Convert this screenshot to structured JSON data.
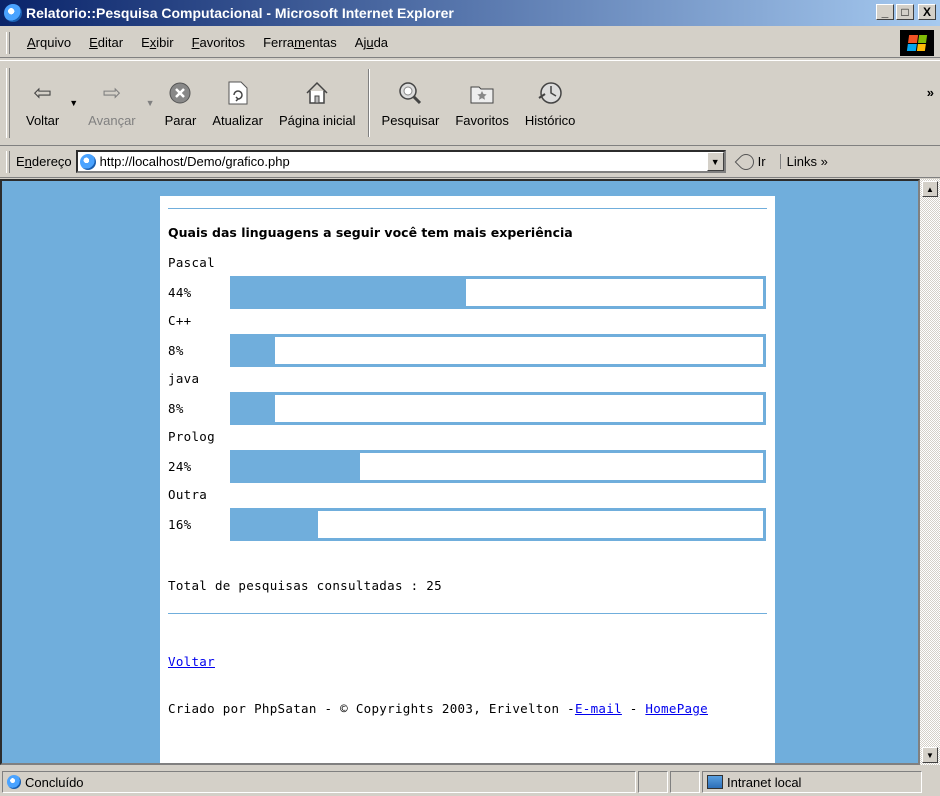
{
  "window": {
    "title": "Relatorio::Pesquisa Computacional - Microsoft Internet Explorer",
    "minimize": "_",
    "maximize": "□",
    "close": "X"
  },
  "menu": [
    {
      "pre": "",
      "key": "A",
      "post": "rquivo"
    },
    {
      "pre": "",
      "key": "E",
      "post": "ditar"
    },
    {
      "pre": "E",
      "key": "x",
      "post": "ibir"
    },
    {
      "pre": "",
      "key": "F",
      "post": "avoritos"
    },
    {
      "pre": "Ferra",
      "key": "m",
      "post": "entas"
    },
    {
      "pre": "Aj",
      "key": "u",
      "post": "da"
    }
  ],
  "toolbar": {
    "back": "Voltar",
    "forward": "Avançar",
    "stop": "Parar",
    "refresh": "Atualizar",
    "home": "Página inicial",
    "search": "Pesquisar",
    "favorites": "Favoritos",
    "history": "Histórico",
    "more": "»"
  },
  "address": {
    "label_key": "n",
    "label_pre": "E",
    "label_post": "dereço",
    "url": "http://localhost/Demo/grafico.php",
    "go": "Ir",
    "links": "Links »"
  },
  "poll": {
    "question": "Quais das linguagens a seguir você tem mais experiência",
    "options": [
      {
        "name": "Pascal",
        "percent_label": "44%",
        "percent": 44
      },
      {
        "name": "C++",
        "percent_label": "8%",
        "percent": 8
      },
      {
        "name": "java",
        "percent_label": "8%",
        "percent": 8
      },
      {
        "name": "Prolog",
        "percent_label": "24%",
        "percent": 24
      },
      {
        "name": "Outra",
        "percent_label": "16%",
        "percent": 16
      }
    ],
    "total": "Total de pesquisas consultadas : 25",
    "back_link": "Voltar",
    "footer_text": "Criado por PhpSatan - © Copyrights 2003, Erivelton -",
    "footer_email": "E-mail",
    "footer_sep": " - ",
    "footer_homepage": "HomePage"
  },
  "status": {
    "text": "Concluído",
    "zone": "Intranet local"
  },
  "colors": {
    "accent": "#70aedc"
  }
}
